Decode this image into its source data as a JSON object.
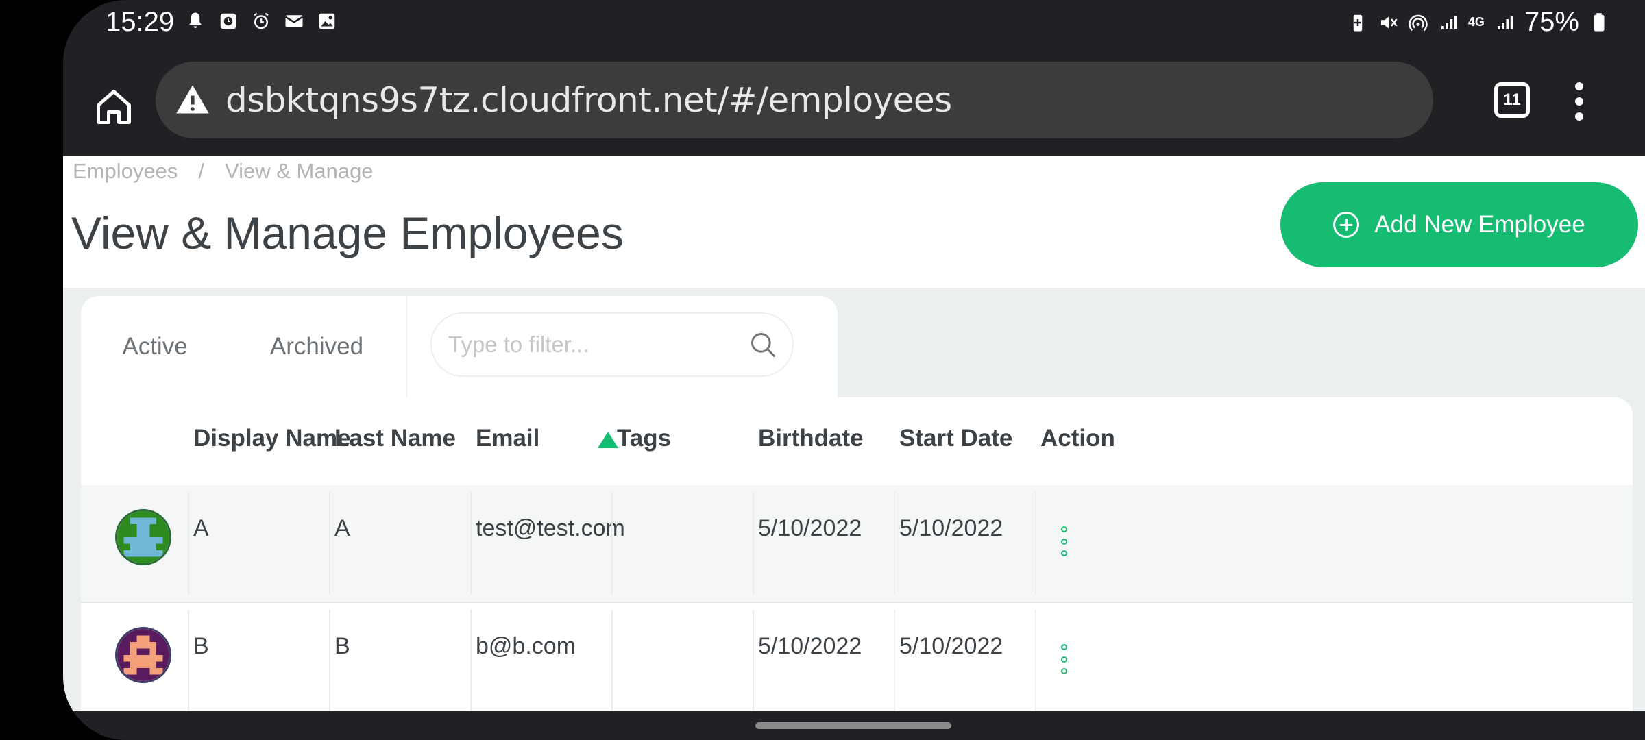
{
  "status_bar": {
    "time": "15:29",
    "battery": "75%",
    "network_label": "4G",
    "left_icons": [
      "bell-icon",
      "clock-app-icon",
      "alarm-icon",
      "mail-icon",
      "image-icon"
    ],
    "right_icons": [
      "battery-saver-icon",
      "mute-icon",
      "hotspot-icon",
      "signal-icon",
      "signal-icon-2",
      "battery-icon"
    ]
  },
  "browser": {
    "url": "dsbktqns9s7tz.cloudfront.net/#/employees",
    "tab_count": "11"
  },
  "breadcrumb": {
    "items": [
      "Employees",
      "View & Manage"
    ],
    "separator": "/"
  },
  "page": {
    "title": "View & Manage Employees",
    "add_button_label": "Add New Employee"
  },
  "tabs": {
    "active_label": "Active",
    "archived_label": "Archived",
    "selected": "Active"
  },
  "filter": {
    "placeholder": "Type to filter...",
    "value": ""
  },
  "table": {
    "columns": [
      "Display Name",
      "Last Name",
      "Email",
      "Tags",
      "Birthdate",
      "Start Date",
      "Action"
    ],
    "sorted_column": "Email",
    "sort_direction": "ascending",
    "rows": [
      {
        "display_name": "A",
        "last_name": "A",
        "email": "test@test.com",
        "tags": "",
        "birthdate": "5/10/2022",
        "start_date": "5/10/2022"
      },
      {
        "display_name": "B",
        "last_name": "B",
        "email": "b@b.com",
        "tags": "",
        "birthdate": "5/10/2022",
        "start_date": "5/10/2022"
      }
    ]
  },
  "colors": {
    "accent": "#16bc72",
    "text_dark": "#3d4247",
    "browser_chrome": "#202124"
  }
}
